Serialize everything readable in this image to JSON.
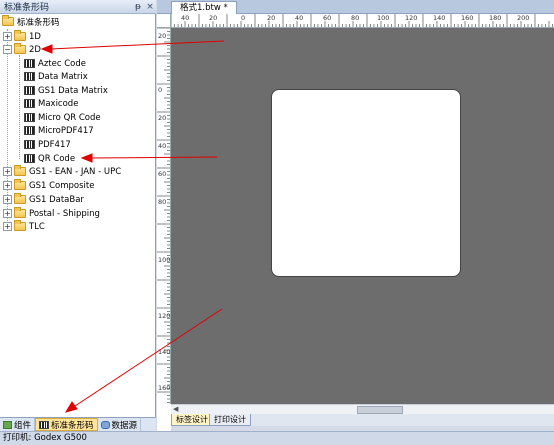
{
  "panel": {
    "title": "标准条形码",
    "pin_glyph": "ᵽ",
    "close_glyph": "×"
  },
  "tree": {
    "root": "标准条形码",
    "nodes": [
      {
        "label": "1D",
        "expander": "+",
        "icon": "folder-icon"
      },
      {
        "label": "2D",
        "expander": "−",
        "icon": "folder-icon"
      },
      {
        "label": "Aztec Code",
        "icon": "barcode-icon"
      },
      {
        "label": "Data Matrix",
        "icon": "barcode-icon"
      },
      {
        "label": "GS1 Data Matrix",
        "icon": "barcode-icon"
      },
      {
        "label": "Maxicode",
        "icon": "barcode-icon"
      },
      {
        "label": "Micro QR Code",
        "icon": "barcode-icon"
      },
      {
        "label": "MicroPDF417",
        "icon": "barcode-icon"
      },
      {
        "label": "PDF417",
        "icon": "barcode-icon"
      },
      {
        "label": "QR Code",
        "icon": "barcode-icon"
      },
      {
        "label": "GS1 - EAN - JAN - UPC",
        "expander": "+",
        "icon": "folder-icon"
      },
      {
        "label": "GS1 Composite",
        "expander": "+",
        "icon": "folder-icon"
      },
      {
        "label": "GS1 DataBar",
        "expander": "+",
        "icon": "folder-icon"
      },
      {
        "label": "Postal - Shipping",
        "expander": "+",
        "icon": "folder-icon"
      },
      {
        "label": "TLC",
        "expander": "+",
        "icon": "folder-icon"
      }
    ]
  },
  "bottom_tabs": [
    {
      "label": "组件",
      "icon": "components-icon"
    },
    {
      "label": "标准条形码",
      "icon": "barcode-icon",
      "active": true
    },
    {
      "label": "数据源",
      "icon": "database-icon"
    }
  ],
  "document": {
    "tab_label": "格式1.btw *",
    "view_tabs": [
      "标签设计",
      "打印设计"
    ]
  },
  "rulers": {
    "top": [
      "40",
      "20",
      "0",
      "20",
      "40",
      "60",
      "80",
      "100",
      "120",
      "140",
      "160",
      "180",
      "200"
    ],
    "left": [
      "20",
      "0",
      "20",
      "40",
      "60",
      "80",
      "100",
      "120",
      "140",
      "160"
    ]
  },
  "status": {
    "text": "打印机: Godex G500"
  },
  "colors": {
    "annotation_arrow": "#e00000",
    "canvas_background": "#6d6d6d"
  }
}
